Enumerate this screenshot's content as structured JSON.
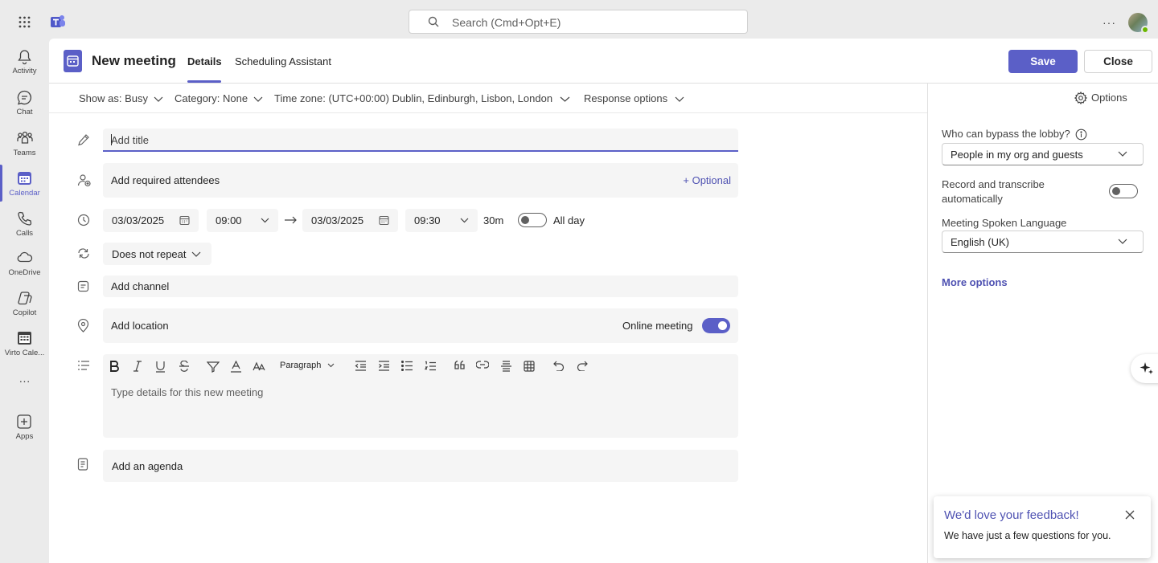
{
  "topbar": {
    "search_placeholder": "Search (Cmd+Opt+E)",
    "more_label": "···"
  },
  "rail": {
    "items": [
      {
        "label": "Activity",
        "icon": "bell-icon"
      },
      {
        "label": "Chat",
        "icon": "chat-icon"
      },
      {
        "label": "Teams",
        "icon": "teams-icon"
      },
      {
        "label": "Calendar",
        "icon": "calendar-icon",
        "active": true
      },
      {
        "label": "Calls",
        "icon": "phone-icon"
      },
      {
        "label": "OneDrive",
        "icon": "cloud-icon"
      },
      {
        "label": "Copilot",
        "icon": "copilot-icon"
      },
      {
        "label": "Virto Cale...",
        "icon": "app-calendar-icon"
      },
      {
        "label": "···",
        "icon": "more-icon"
      },
      {
        "label": "Apps",
        "icon": "plus-square-icon"
      }
    ]
  },
  "header": {
    "title": "New meeting",
    "tabs": [
      {
        "label": "Details",
        "active": true
      },
      {
        "label": "Scheduling Assistant",
        "active": false
      }
    ],
    "save_label": "Save",
    "close_label": "Close"
  },
  "options": {
    "show_as": "Show as: Busy",
    "category": "Category: None",
    "timezone_label": "Time zone:",
    "timezone_value": "(UTC+00:00) Dublin, Edinburgh, Lisbon, London",
    "response": "Response options",
    "panel_options": "Options"
  },
  "form": {
    "title_placeholder": "Add title",
    "attendees_placeholder": "Add required attendees",
    "optional_label": "+ Optional",
    "start_date": "03/03/2025",
    "start_time": "09:00",
    "end_date": "03/03/2025",
    "end_time": "09:30",
    "duration": "30m",
    "all_day_label": "All day",
    "all_day": false,
    "repeat_label": "Does not repeat",
    "channel_placeholder": "Add channel",
    "location_placeholder": "Add location",
    "online_meeting_label": "Online meeting",
    "online_meeting": true,
    "editor_format": "Paragraph",
    "details_placeholder": "Type details for this new meeting",
    "agenda_label": "Add an agenda"
  },
  "panel": {
    "lobby_label": "Who can bypass the lobby?",
    "lobby_value": "People in my org and guests",
    "record_label_line1": "Record and transcribe",
    "record_label_line2": "automatically",
    "record": false,
    "language_label": "Meeting Spoken Language",
    "language_value": "English (UK)",
    "more_options": "More options"
  },
  "feedback": {
    "title": "We'd love your feedback!",
    "body": "We have just a few questions for you."
  },
  "colors": {
    "accent": "#5b5fc7",
    "link": "#4f52b2",
    "rail_bg": "#ebebeb",
    "field_bg": "#f5f5f5"
  }
}
